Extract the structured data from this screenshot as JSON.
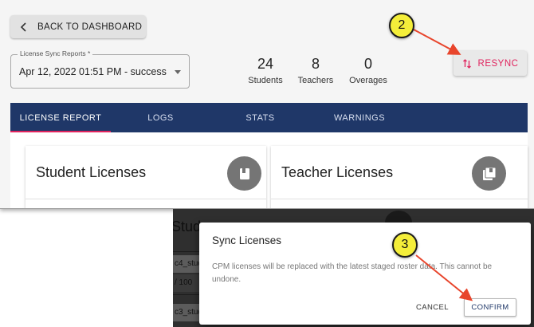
{
  "app": {
    "back_label": "BACK TO DASHBOARD",
    "select": {
      "label": "License Sync Reports *",
      "value": "Apr 12, 2022 01:51 PM - success"
    },
    "stats": [
      {
        "value": "24",
        "label": "Students"
      },
      {
        "value": "8",
        "label": "Teachers"
      },
      {
        "value": "0",
        "label": "Overages"
      }
    ],
    "resync_label": "RESYNC",
    "tabs": [
      {
        "label": "LICENSE REPORT",
        "active": true
      },
      {
        "label": "LOGS",
        "active": false
      },
      {
        "label": "STATS",
        "active": false
      },
      {
        "label": "WARNINGS",
        "active": false
      }
    ],
    "cards": [
      {
        "title": "Student Licenses",
        "icon": "book-icon"
      },
      {
        "title": "Teacher Licenses",
        "icon": "library-books-icon"
      }
    ]
  },
  "dialog": {
    "title": "Sync Licenses",
    "body": "CPM licenses will be replaced with the latest staged roster data. This cannot be undone.",
    "cancel_label": "CANCEL",
    "confirm_label": "CONFIRM"
  },
  "background_fragments": {
    "card_title": "Stude",
    "row1": "c4_stud",
    "row2": "/ 100",
    "row3": "c3_stud"
  },
  "annotations": {
    "step_a": "2",
    "step_b": "3"
  },
  "colors": {
    "navy": "#1f3768",
    "accent": "#e0245e",
    "callout_fill": "#f4ee3a",
    "arrow": "#e8452c"
  }
}
